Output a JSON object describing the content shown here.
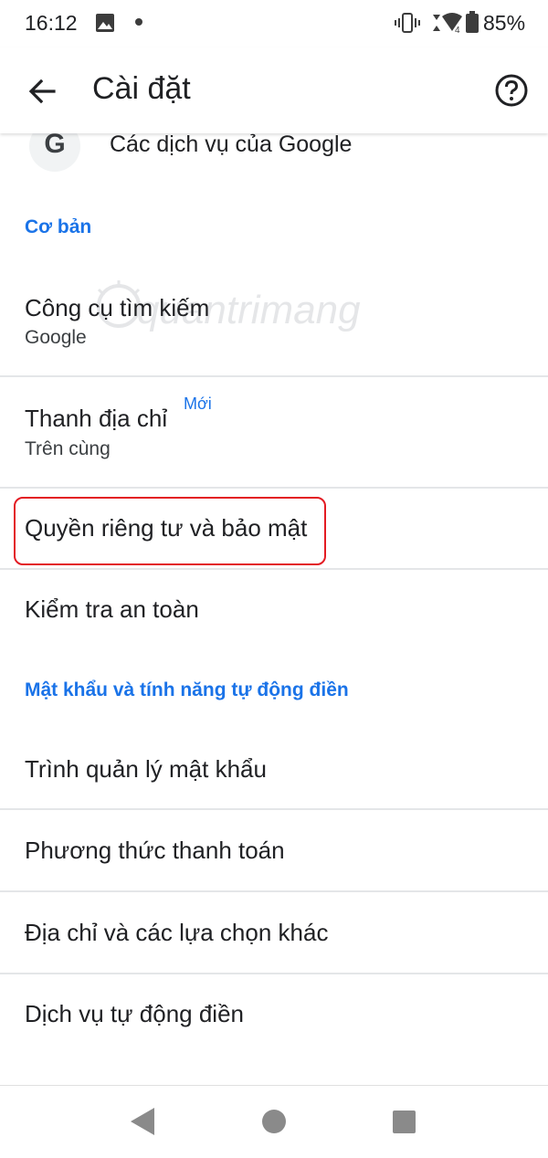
{
  "status_bar": {
    "time": "16:12",
    "battery": "85%",
    "signal_badge": "4"
  },
  "app_bar": {
    "title": "Cài đặt",
    "back_icon": "arrow-back-icon",
    "help_icon": "help-circle-icon"
  },
  "google_services": {
    "logo": "G",
    "label": "Các dịch vụ của Google"
  },
  "sections": {
    "basic": "Cơ bản",
    "passwords": "Mật khẩu và tính năng tự động điền"
  },
  "basic_items": {
    "search_engine": {
      "title": "Công cụ tìm kiếm",
      "subtitle": "Google"
    },
    "address_bar": {
      "title": "Thanh địa chỉ",
      "badge": "Mới",
      "subtitle": "Trên cùng"
    },
    "privacy": {
      "title": "Quyền riêng tư và bảo mật"
    },
    "safety_check": {
      "title": "Kiểm tra an toàn"
    }
  },
  "autofill_items": {
    "password_manager": "Trình quản lý mật khẩu",
    "payment_methods": "Phương thức thanh toán",
    "addresses": "Địa chỉ và các lựa chọn khác",
    "autofill_service": "Dịch vụ tự động điền"
  },
  "watermark": "quantrimang",
  "colors": {
    "accent": "#1a73e8",
    "highlight": "#e31b23",
    "text": "#202124",
    "divider": "#e4e6e8"
  }
}
